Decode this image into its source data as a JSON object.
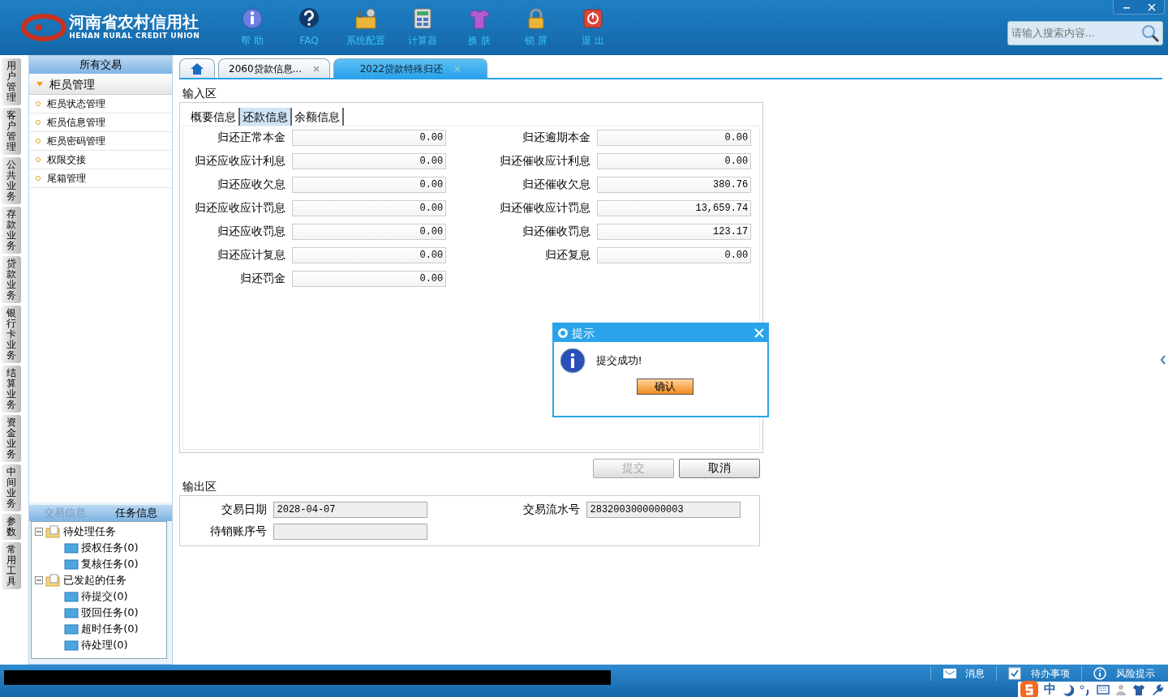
{
  "header": {
    "logo": {
      "name_cn": "河南省农村信用社",
      "name_en": "HENAN RURAL CREDIT UNION"
    },
    "toolbar": [
      {
        "kind": "help",
        "label": "帮 助"
      },
      {
        "kind": "faq",
        "label": "FAQ"
      },
      {
        "kind": "settings",
        "label": "系统配置"
      },
      {
        "kind": "calculator",
        "label": "计算器"
      },
      {
        "kind": "skin",
        "label": "换 肤"
      },
      {
        "kind": "lock",
        "label": "锁 屏"
      },
      {
        "kind": "exit",
        "label": "退 出"
      }
    ],
    "search": {
      "placeholder": "请输入搜索内容..."
    }
  },
  "side_tabs": [
    "用户管理",
    "客户管理",
    "公共业务",
    "存款业务",
    "贷款业务",
    "银行卡业务",
    "结算业务",
    "资金业务",
    "中间业务",
    "参数",
    "常用工具"
  ],
  "sidebar": {
    "title": "所有交易",
    "group": {
      "label": "柜员管理",
      "expanded": true,
      "items": [
        "柜员状态管理",
        "柜员信息管理",
        "柜员密码管理",
        "权限交接",
        "尾箱管理"
      ]
    },
    "panel_tabs": [
      {
        "label": "交易信息",
        "selected": false
      },
      {
        "label": "任务信息",
        "selected": true
      }
    ],
    "tree": [
      {
        "label": "待处理任务",
        "expanded": true,
        "children": [
          {
            "label": "授权任务(0)"
          },
          {
            "label": "复核任务(0)"
          }
        ]
      },
      {
        "label": "已发起的任务",
        "expanded": true,
        "children": [
          {
            "label": "待提交(0)"
          },
          {
            "label": "驳回任务(0)"
          },
          {
            "label": "超时任务(0)"
          },
          {
            "label": "待处理(0)"
          }
        ]
      }
    ]
  },
  "tabs": [
    {
      "kind": "home",
      "selected": false
    },
    {
      "kind": "page",
      "label": "2060贷款信息...",
      "selected": false
    },
    {
      "kind": "page",
      "label": "2022贷款特殊归还",
      "selected": true
    }
  ],
  "input_section": {
    "title": "输入区",
    "subtabs": [
      {
        "label": "概要信息",
        "selected": false
      },
      {
        "label": "还款信息",
        "selected": true
      },
      {
        "label": "余额信息",
        "selected": false
      }
    ],
    "fields": [
      {
        "label": "归还正常本金",
        "value": "0.00"
      },
      {
        "label": "归还逾期本金",
        "value": "0.00"
      },
      {
        "label": "归还应收应计利息",
        "value": "0.00"
      },
      {
        "label": "归还催收应计利息",
        "value": "0.00"
      },
      {
        "label": "归还应收欠息",
        "value": "0.00"
      },
      {
        "label": "归还催收欠息",
        "value": "380.76"
      },
      {
        "label": "归还应收应计罚息",
        "value": "0.00"
      },
      {
        "label": "归还催收应计罚息",
        "value": "13,659.74"
      },
      {
        "label": "归还应收罚息",
        "value": "0.00"
      },
      {
        "label": "归还催收罚息",
        "value": "123.17"
      },
      {
        "label": "归还应计复息",
        "value": "0.00"
      },
      {
        "label": "归还复息",
        "value": "0.00"
      },
      {
        "label": "归还罚金",
        "value": "0.00"
      }
    ]
  },
  "buttons": [
    {
      "label": "提交",
      "disabled": true
    },
    {
      "label": "取消",
      "disabled": false
    }
  ],
  "output_section": {
    "title": "输出区",
    "fields": [
      {
        "label": "交易日期",
        "value": "2028-04-07"
      },
      {
        "label": "交易流水号",
        "value": "2832003000000003"
      },
      {
        "label": "待销账序号"
      }
    ]
  },
  "dialog": {
    "title": "提示",
    "message": "提交成功!",
    "button": "确认"
  },
  "status_bar": [
    {
      "kind": "message",
      "label": "消息"
    },
    {
      "kind": "todo",
      "label": "待办事项"
    },
    {
      "kind": "risk",
      "label": "风险提示"
    }
  ],
  "ime": {
    "mode": "中"
  }
}
